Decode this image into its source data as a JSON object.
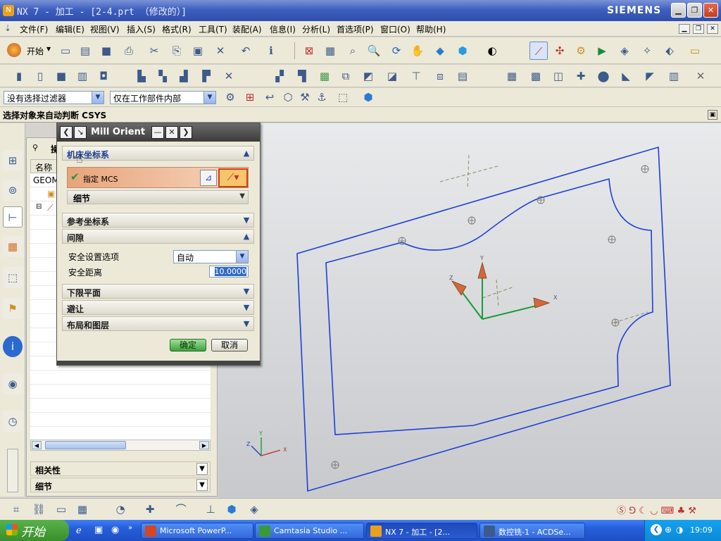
{
  "window": {
    "title": "NX 7 - 加工 - [2-4.prt （修改的）]",
    "brand": "SIEMENS"
  },
  "menubar": {
    "items": [
      "文件(F)",
      "编辑(E)",
      "视图(V)",
      "插入(S)",
      "格式(R)",
      "工具(T)",
      "装配(A)",
      "信息(I)",
      "分析(L)",
      "首选项(P)",
      "窗口(O)",
      "帮助(H)"
    ]
  },
  "toolbar": {
    "start_label": "开始"
  },
  "selection": {
    "filter": "没有选择过滤器",
    "scope": "仅在工作部件内部"
  },
  "cue": "选择对象来自动判断 CSYS",
  "navigator": {
    "title": "操",
    "column_header": "名称",
    "rows": [
      "GEOM"
    ],
    "sections": {
      "related": "相关性",
      "details": "细节"
    }
  },
  "dialog": {
    "title": "Mill Orient",
    "groups": {
      "machine_csys": "机床坐标系",
      "specify_mcs": "指定 MCS",
      "details": "细节",
      "ref_csys": "参考坐标系",
      "clearance": "间隙",
      "safe_option_label": "安全设置选项",
      "safe_option_value": "自动",
      "safe_distance_label": "安全距离",
      "safe_distance_value": "10.0000",
      "lower_plane": "下限平面",
      "avoidance": "避让",
      "layout_layer": "布局和图层"
    },
    "ok": "确定",
    "cancel": "取消"
  },
  "graphics": {
    "axis_labels": {
      "x": "X",
      "y": "Y",
      "z": "Z"
    }
  },
  "taskbar": {
    "start": "开始",
    "tasks": [
      {
        "label": "Microsoft PowerP...",
        "icon_color": "#d24726"
      },
      {
        "label": "Camtasia Studio ...",
        "icon_color": "#3a9a3a"
      },
      {
        "label": "NX 7 - 加工 - [2...",
        "icon_color": "#e8a020"
      },
      {
        "label": "数控铣-1 - ACDSe...",
        "icon_color": "#3c5a8a"
      }
    ],
    "clock": "19:09"
  },
  "colors": {
    "model_edge": "#1c3fd8",
    "wcs_x": "#1b9a3a",
    "titlebar": "#2f4fae"
  }
}
